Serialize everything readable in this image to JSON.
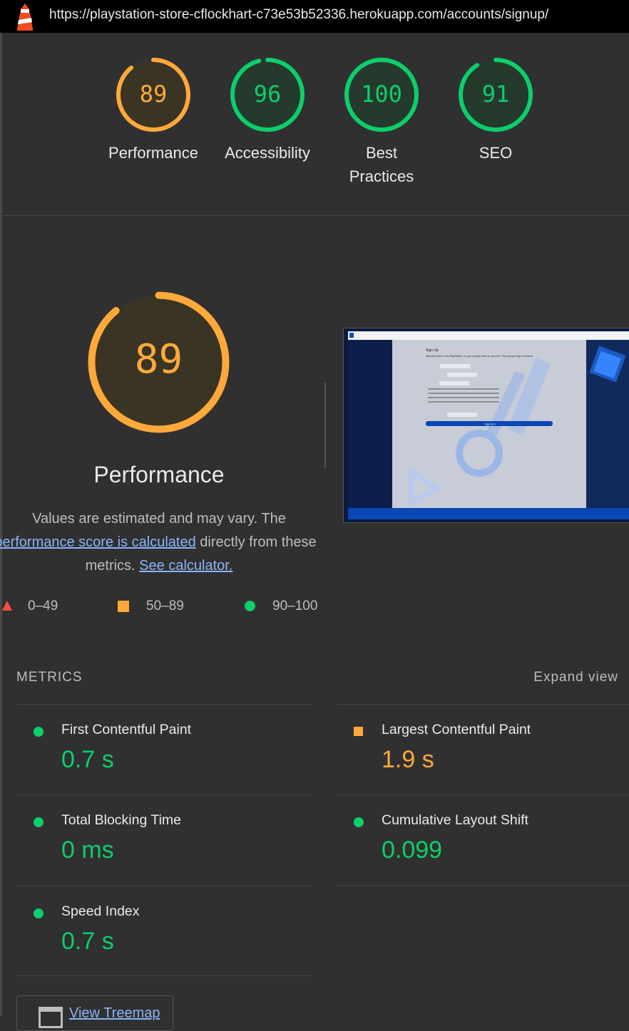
{
  "url": "https://playstation-store-cflockhart-c73e53b52336.herokuapp.com/accounts/signup/",
  "gauges": [
    {
      "score": "89",
      "label": "Performance",
      "color": "#ffa93a",
      "fraction": 0.89
    },
    {
      "score": "96",
      "label": "Accessibility",
      "color": "#0cce6b",
      "fraction": 0.96
    },
    {
      "score": "100",
      "label_line1": "Best",
      "label_line2": "Practices",
      "color": "#0cce6b",
      "fraction": 1.0
    },
    {
      "score": "91",
      "label": "SEO",
      "color": "#0cce6b",
      "fraction": 0.91
    }
  ],
  "performance": {
    "score": "89",
    "fraction": 0.89,
    "title": "Performance",
    "desc_1": "Values are estimated and may vary. The",
    "desc_link_1": "performance score is calculated",
    "desc_2": " directly from these",
    "desc_3": "metrics. ",
    "desc_link_2": "See calculator."
  },
  "legend": {
    "fail": "0–49",
    "average": "50–89",
    "pass": "90–100"
  },
  "metrics": {
    "heading": "METRICS",
    "expand": "Expand view",
    "items": [
      {
        "name": "First Contentful Paint",
        "value": "0.7 s",
        "status": "pass"
      },
      {
        "name": "Largest Contentful Paint",
        "value": "1.9 s",
        "status": "average"
      },
      {
        "name": "Total Blocking Time",
        "value": "0 ms",
        "status": "pass"
      },
      {
        "name": "Cumulative Layout Shift",
        "value": "0.099",
        "status": "pass"
      },
      {
        "name": "Speed Index",
        "value": "0.7 s",
        "status": "pass"
      }
    ]
  },
  "treemap_label": "View Treemap",
  "thumbnail": {
    "heading": "Sign Up",
    "intro": "Welcome back to the PlayStation. Do you already have an account? Then please Sign In instead.",
    "button": "Sign Up »"
  }
}
